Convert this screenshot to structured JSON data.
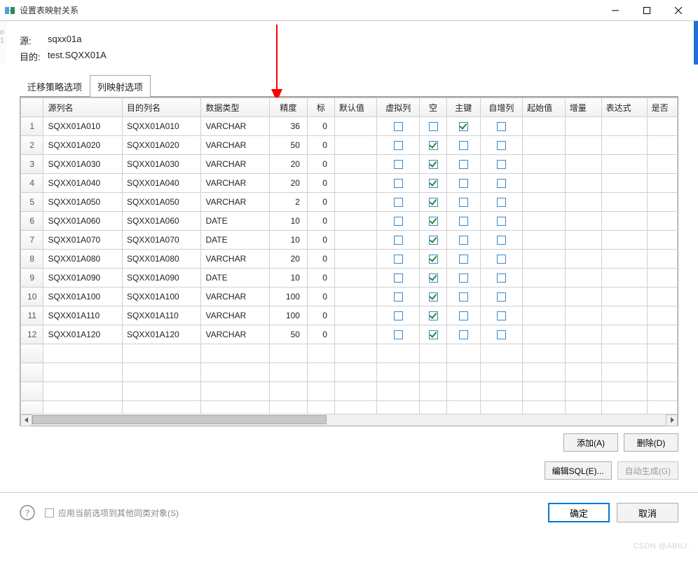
{
  "window": {
    "title": "设置表映射关系",
    "minimize": "–",
    "maximize": "□",
    "close": "×"
  },
  "info": {
    "source_label": "源:",
    "source_value": "sqxx01a",
    "target_label": "目的:",
    "target_value": "test.SQXX01A"
  },
  "tabs": {
    "migration": "迁移策略选项",
    "mapping": "列映射选项"
  },
  "columns": {
    "rownum": "",
    "src": "源列名",
    "dst": "目的列名",
    "type": "数据类型",
    "precision": "精度",
    "scale": "标",
    "default": "默认值",
    "virtual": "虚拟列",
    "nullable": "空",
    "pk": "主键",
    "autoinc": "自增列",
    "start": "起始值",
    "increment": "增量",
    "expr": "表达式",
    "iscol": "是否"
  },
  "rows": [
    {
      "n": "1",
      "src": "SQXX01A010",
      "dst": "SQXX01A010",
      "type": "VARCHAR",
      "prec": "36",
      "scale": "0",
      "virtual": false,
      "null": false,
      "pk": true,
      "auto": false
    },
    {
      "n": "2",
      "src": "SQXX01A020",
      "dst": "SQXX01A020",
      "type": "VARCHAR",
      "prec": "50",
      "scale": "0",
      "virtual": false,
      "null": true,
      "pk": false,
      "auto": false
    },
    {
      "n": "3",
      "src": "SQXX01A030",
      "dst": "SQXX01A030",
      "type": "VARCHAR",
      "prec": "20",
      "scale": "0",
      "virtual": false,
      "null": true,
      "pk": false,
      "auto": false
    },
    {
      "n": "4",
      "src": "SQXX01A040",
      "dst": "SQXX01A040",
      "type": "VARCHAR",
      "prec": "20",
      "scale": "0",
      "virtual": false,
      "null": true,
      "pk": false,
      "auto": false
    },
    {
      "n": "5",
      "src": "SQXX01A050",
      "dst": "SQXX01A050",
      "type": "VARCHAR",
      "prec": "2",
      "scale": "0",
      "virtual": false,
      "null": true,
      "pk": false,
      "auto": false
    },
    {
      "n": "6",
      "src": "SQXX01A060",
      "dst": "SQXX01A060",
      "type": "DATE",
      "prec": "10",
      "scale": "0",
      "virtual": false,
      "null": true,
      "pk": false,
      "auto": false
    },
    {
      "n": "7",
      "src": "SQXX01A070",
      "dst": "SQXX01A070",
      "type": "DATE",
      "prec": "10",
      "scale": "0",
      "virtual": false,
      "null": true,
      "pk": false,
      "auto": false
    },
    {
      "n": "8",
      "src": "SQXX01A080",
      "dst": "SQXX01A080",
      "type": "VARCHAR",
      "prec": "20",
      "scale": "0",
      "virtual": false,
      "null": true,
      "pk": false,
      "auto": false
    },
    {
      "n": "9",
      "src": "SQXX01A090",
      "dst": "SQXX01A090",
      "type": "DATE",
      "prec": "10",
      "scale": "0",
      "virtual": false,
      "null": true,
      "pk": false,
      "auto": false
    },
    {
      "n": "10",
      "src": "SQXX01A100",
      "dst": "SQXX01A100",
      "type": "VARCHAR",
      "prec": "100",
      "scale": "0",
      "virtual": false,
      "null": true,
      "pk": false,
      "auto": false
    },
    {
      "n": "11",
      "src": "SQXX01A110",
      "dst": "SQXX01A110",
      "type": "VARCHAR",
      "prec": "100",
      "scale": "0",
      "virtual": false,
      "null": true,
      "pk": false,
      "auto": false
    },
    {
      "n": "12",
      "src": "SQXX01A120",
      "dst": "SQXX01A120",
      "type": "VARCHAR",
      "prec": "50",
      "scale": "0",
      "virtual": false,
      "null": true,
      "pk": false,
      "auto": false
    }
  ],
  "buttons": {
    "add": "添加(A)",
    "delete": "删除(D)",
    "editsql": "编辑SQL(E)...",
    "autogen": "自动生成(G)",
    "ok": "确定",
    "cancel": "取消"
  },
  "footer": {
    "apply_all": "应用当前选项到其他同类对象(S)"
  },
  "watermark": "CSDN @ABILI ."
}
